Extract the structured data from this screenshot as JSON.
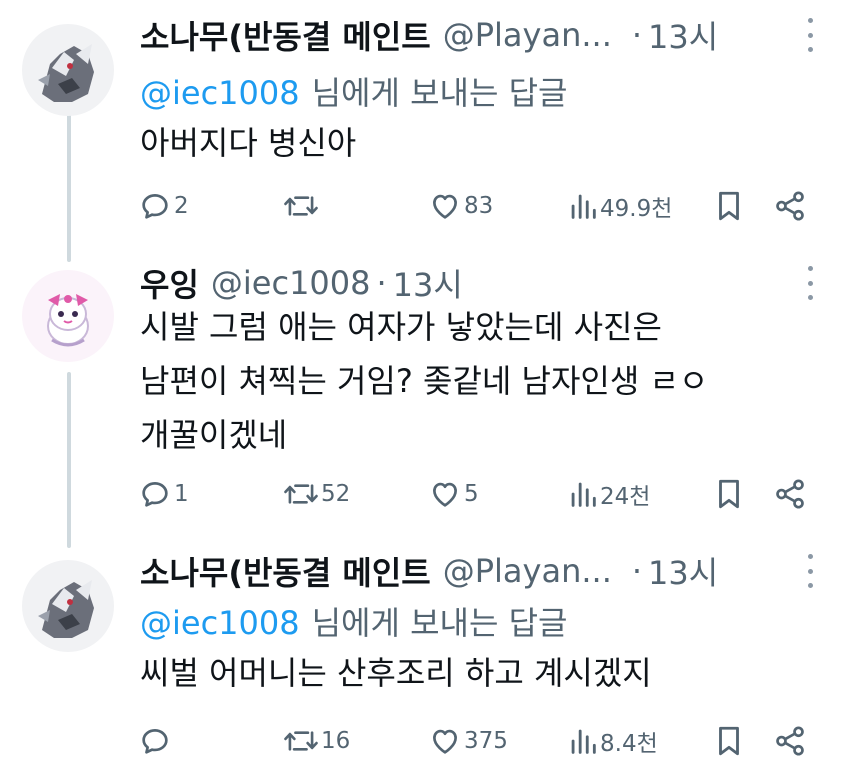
{
  "tweets": [
    {
      "name": "소나무(반동결 메인트",
      "handle": "@Playan...",
      "time": "13시",
      "reply_to": "@iec1008",
      "reply_suffix": "님에게 보내는 답글",
      "lines": [
        "아버지다 병신아"
      ],
      "replies": "2",
      "retweets": "",
      "likes": "83",
      "views": "49.9천",
      "avatar": "pokemon-avatar"
    },
    {
      "name": "우잉",
      "handle": "@iec1008",
      "time": "13시",
      "lines": [
        "시발 그럼 애는 여자가 낳았는데 사진은",
        "남편이 쳐찍는 거임? 좆같네 남자인생 ㄹㅇ",
        "개꿀이겠네"
      ],
      "replies": "1",
      "retweets": "52",
      "likes": "5",
      "views": "24천",
      "avatar": "character-avatar"
    },
    {
      "name": "소나무(반동결 메인트",
      "handle": "@Playan...",
      "time": "13시",
      "reply_to": "@iec1008",
      "reply_suffix": "님에게 보내는 답글",
      "lines": [
        "씨벌 어머니는 산후조리 하고 계시겠지"
      ],
      "replies": "",
      "retweets": "16",
      "likes": "375",
      "views": "8.4천",
      "avatar": "pokemon-avatar"
    }
  ],
  "colors": {
    "text": "#0f1419",
    "secondary": "#536471",
    "accent": "#1d9bf0",
    "thread": "#cfd9de"
  },
  "icons": [
    "reply-icon",
    "retweet-icon",
    "like-icon",
    "views-icon",
    "bookmark-icon",
    "share-icon",
    "more-icon"
  ]
}
